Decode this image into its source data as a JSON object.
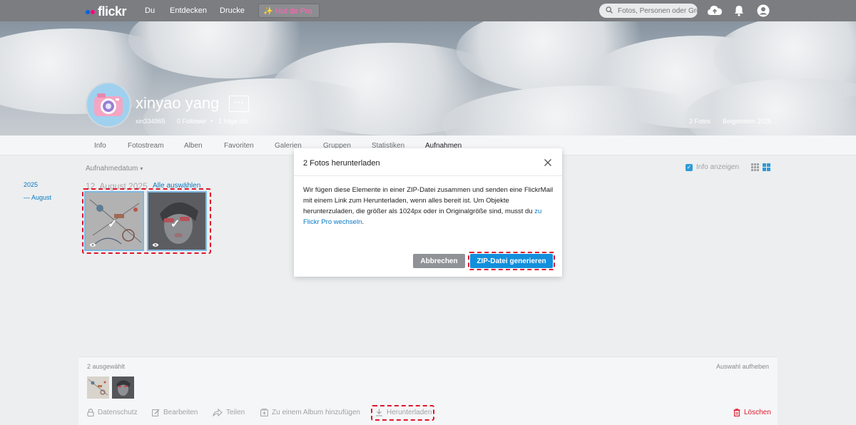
{
  "app": {
    "logo_text": "flickr",
    "logo_colors": [
      "#0063dc",
      "#ff0084"
    ]
  },
  "nav": {
    "links": [
      "Du",
      "Entdecken",
      "Drucke"
    ],
    "pro_label": "Hol dir Pro.",
    "pro_star": "✨",
    "search_placeholder": "Fotos, Personen oder Gruppen"
  },
  "profile": {
    "name": "xinyao yang",
    "username": "xin334965",
    "followers": "0 Follower",
    "following": "1 folge ich",
    "separator": "•",
    "more_label": "···",
    "photos_count": "2 Fotos",
    "joined": "Beigetreten 2025"
  },
  "tabs": [
    "Info",
    "Fotostream",
    "Alben",
    "Favoriten",
    "Galerien",
    "Gruppen",
    "Statistiken",
    "Aufnahmen"
  ],
  "content": {
    "sort_label": "Aufnahmedatum",
    "sort_caret": "▾",
    "year": "2025",
    "month": "August",
    "month_prefix": "—",
    "date_heading": "12. August 2025",
    "select_all": "Alle auswählen",
    "info_toggle": "Info anzeigen",
    "check_glyph": "✓"
  },
  "modal": {
    "title": "2 Fotos herunterladen",
    "body": "Wir fügen diese Elemente in einer ZIP-Datei zusammen und senden eine FlickrMail mit einem Link zum Herunterladen, wenn alles bereit ist. Um Objekte herunterzuladen, die größer als 1024px oder in Originalgröße sind, musst du ",
    "link": "zu Flickr Pro wechseln",
    "body_end": ".",
    "cancel_label": "Abbrechen",
    "confirm_label": "ZIP-Datei generieren"
  },
  "selection": {
    "count": "2 ausgewählt",
    "clear": "Auswahl aufheben",
    "actions": [
      "Datenschutz",
      "Bearbeiten",
      "Teilen",
      "Zu einem Album hinzufügen",
      "Herunterladen"
    ],
    "delete_label": "Löschen"
  },
  "colors": {
    "accent": "#128fdc",
    "danger": "#e0162b",
    "nav_bg": "#7b7d80"
  }
}
